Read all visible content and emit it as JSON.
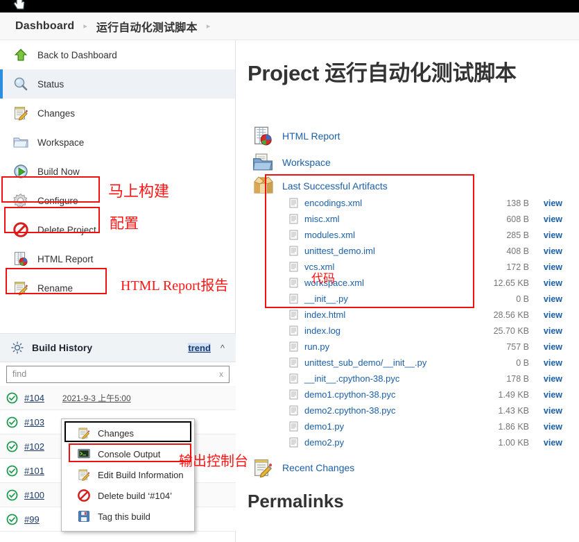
{
  "window": {
    "cursor_icon": "hand-pointer-cursor"
  },
  "breadcrumb": {
    "items": [
      {
        "label": "Dashboard"
      },
      {
        "label": "运行自动化测试脚本"
      }
    ],
    "separator": "▸"
  },
  "sidebar": {
    "tasks": [
      {
        "label": "Back to Dashboard",
        "icon": "up-arrow-icon",
        "selected": false
      },
      {
        "label": "Status",
        "icon": "magnifier-icon",
        "selected": true
      },
      {
        "label": "Changes",
        "icon": "notepad-pencil-icon",
        "selected": false
      },
      {
        "label": "Workspace",
        "icon": "folder-icon",
        "selected": false
      },
      {
        "label": "Build Now",
        "icon": "play-clock-icon",
        "selected": false
      },
      {
        "label": "Configure",
        "icon": "gear-icon",
        "selected": false
      },
      {
        "label": "Delete Project",
        "icon": "no-entry-icon",
        "selected": false
      },
      {
        "label": "HTML Report",
        "icon": "report-chart-icon",
        "selected": false
      },
      {
        "label": "Rename",
        "icon": "notepad-pencil-icon",
        "selected": false
      }
    ],
    "annotations": [
      {
        "text": "马上构建",
        "target": "Build Now"
      },
      {
        "text": "配置",
        "target": "Configure"
      },
      {
        "text": "HTML Report报告",
        "target": "HTML Report"
      }
    ]
  },
  "build_history": {
    "icon": "gear-sun-icon",
    "title": "Build History",
    "trend_label": "trend",
    "collapse_icon": "chevron-up-icon",
    "find_placeholder": "find",
    "find_value": "",
    "find_clear_label": "x",
    "rows": [
      {
        "status": "success",
        "number": "#104",
        "date": "2021-9-3 上午5:00"
      },
      {
        "status": "success",
        "number": "#103",
        "date": ""
      },
      {
        "status": "success",
        "number": "#102",
        "date": ""
      },
      {
        "status": "success",
        "number": "#101",
        "date": ""
      },
      {
        "status": "success",
        "number": "#100",
        "date": ""
      },
      {
        "status": "success",
        "number": "#99",
        "date": ""
      }
    ]
  },
  "context_menu": {
    "items": [
      {
        "label": "Changes",
        "icon": "notepad-pencil-icon",
        "highlight": "black"
      },
      {
        "label": "Console Output",
        "icon": "console-terminal-icon",
        "highlight": "red"
      },
      {
        "label": "Edit Build Information",
        "icon": "notepad-pencil-icon",
        "highlight": "none"
      },
      {
        "label": "Delete build ‘#104’",
        "icon": "no-entry-icon",
        "highlight": "none"
      },
      {
        "label": "Tag this build",
        "icon": "floppy-disk-icon",
        "highlight": "none"
      }
    ],
    "annotation": "输出控制台"
  },
  "main": {
    "title": "Project 运行自动化测试脚本",
    "links": [
      {
        "label": "HTML Report",
        "icon": "report-chart-icon"
      },
      {
        "label": "Workspace",
        "icon": "folder-docs-icon"
      }
    ],
    "artifacts": {
      "heading": "Last Successful Artifacts",
      "icon": "package-box-icon",
      "view_label": "view",
      "annotation": "代码",
      "files": [
        {
          "name": "encodings.xml",
          "size": "138 B",
          "view": "view"
        },
        {
          "name": "misc.xml",
          "size": "608 B",
          "view": "view"
        },
        {
          "name": "modules.xml",
          "size": "285 B",
          "view": "view"
        },
        {
          "name": "unittest_demo.iml",
          "size": "408 B",
          "view": "view"
        },
        {
          "name": "vcs.xml",
          "size": "172 B",
          "view": "view"
        },
        {
          "name": "workspace.xml",
          "size": "12.65 KB",
          "view": "view"
        },
        {
          "name": "__init__.py",
          "size": "0 B",
          "view": "view"
        },
        {
          "name": "index.html",
          "size": "28.56 KB",
          "view": "view"
        },
        {
          "name": "index.log",
          "size": "25.70 KB",
          "view": "view"
        },
        {
          "name": "run.py",
          "size": "757 B",
          "view": "view"
        },
        {
          "name": "unittest_sub_demo/__init__.py",
          "size": "0 B",
          "view": "view"
        },
        {
          "name": "__init__.cpython-38.pyc",
          "size": "178 B",
          "view": "view"
        },
        {
          "name": "demo1.cpython-38.pyc",
          "size": "1.49 KB",
          "view": "view"
        },
        {
          "name": "demo2.cpython-38.pyc",
          "size": "1.43 KB",
          "view": "view"
        },
        {
          "name": "demo1.py",
          "size": "1.86 KB",
          "view": "view"
        },
        {
          "name": "demo2.py",
          "size": "1.00 KB",
          "view": "view"
        }
      ]
    },
    "recent_changes": {
      "label": "Recent Changes",
      "icon": "notepad-pencil-icon"
    },
    "permalinks_heading": "Permalinks"
  },
  "colors": {
    "accent_link": "#1b5fa8",
    "annotation_red": "#ff1414",
    "selected_bar": "#2b8ee0",
    "success_green": "#1d9b4e"
  }
}
